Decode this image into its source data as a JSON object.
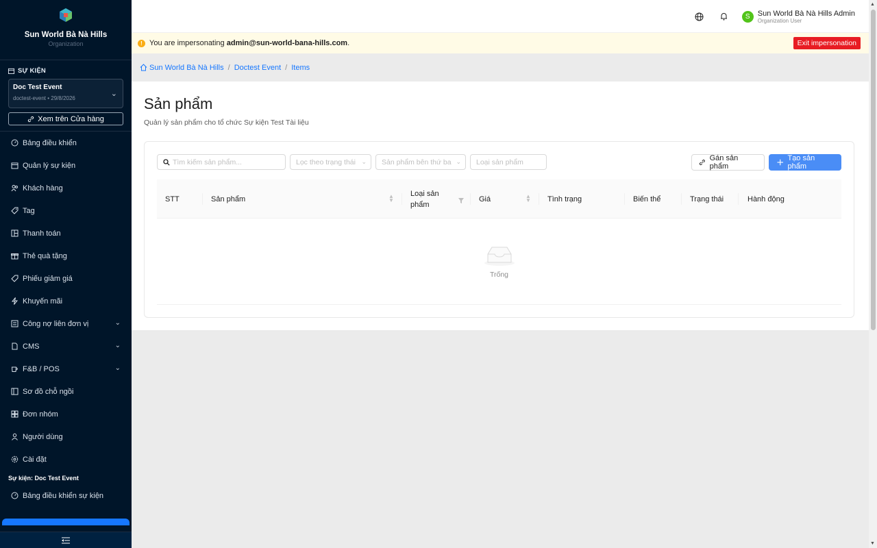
{
  "sidebar": {
    "brand_name": "Sun World Bà Nà Hills",
    "brand_sub": "Organization",
    "section_events": "SỰ KIỆN",
    "event_name": "Doc Test Event",
    "event_meta": "doctest-event • 29/8/2026",
    "store_button": "Xem trên Cửa hàng",
    "menu": [
      {
        "label": "Bảng điều khiển",
        "icon": "dashboard-icon"
      },
      {
        "label": "Quản lý sự kiện",
        "icon": "calendar-icon"
      },
      {
        "label": "Khách hàng",
        "icon": "users-icon"
      },
      {
        "label": "Tag",
        "icon": "tag-icon"
      },
      {
        "label": "Thanh toán",
        "icon": "payment-icon"
      },
      {
        "label": "Thẻ quà tặng",
        "icon": "gift-icon"
      },
      {
        "label": "Phiếu giảm giá",
        "icon": "coupon-icon"
      },
      {
        "label": "Khuyến mãi",
        "icon": "promo-icon"
      },
      {
        "label": "Công nợ liên đơn vị",
        "icon": "ledger-icon",
        "submenu": true
      },
      {
        "label": "CMS",
        "icon": "cms-icon",
        "submenu": true
      },
      {
        "label": "F&B / POS",
        "icon": "coffee-icon",
        "submenu": true
      },
      {
        "label": "Sơ đồ chỗ ngồi",
        "icon": "seatmap-icon"
      },
      {
        "label": "Đơn nhóm",
        "icon": "group-icon"
      },
      {
        "label": "Người dùng",
        "icon": "user-icon"
      },
      {
        "label": "Cài đặt",
        "icon": "settings-icon"
      }
    ],
    "section_event_label": "Sự kiện: Doc Test Event",
    "event_menu": [
      {
        "label": "Bảng điều khiển sự kiện",
        "icon": "dashboard-icon"
      }
    ]
  },
  "header": {
    "user_name": "Sun World Bà Nà Hills Admin",
    "user_role": "Organization User",
    "avatar_letter": "S"
  },
  "banner": {
    "prefix": "You are impersonating ",
    "email": "admin@sun-world-bana-hills.com",
    "suffix": ".",
    "exit_button": "Exit impersonation"
  },
  "breadcrumb": [
    "Sun World Bà Nà Hills",
    "Doctest Event",
    "Items"
  ],
  "page": {
    "title": "Sản phẩm",
    "subtitle": "Quản lý sản phẩm cho tổ chức Sự kiện Test Tài liệu"
  },
  "filters": {
    "search_placeholder": "Tìm kiếm sản phẩm...",
    "status_placeholder": "Lọc theo trạng thái",
    "third_party_placeholder": "Sản phẩm bên thứ ba",
    "type_placeholder": "Loại sản phẩm"
  },
  "actions": {
    "assign": "Gán sản phẩm",
    "create": "Tạo sản phẩm"
  },
  "table": {
    "columns": [
      "STT",
      "Sản phẩm",
      "Loại sản phẩm",
      "Giá",
      "Tình trạng",
      "Biến thể",
      "Trạng thái",
      "Hành động"
    ],
    "empty_text": "Trống"
  },
  "colors": {
    "sidebar_bg": "#001529",
    "primary": "#1677ff",
    "danger": "#e81c23",
    "banner_bg": "#fffbe6"
  }
}
